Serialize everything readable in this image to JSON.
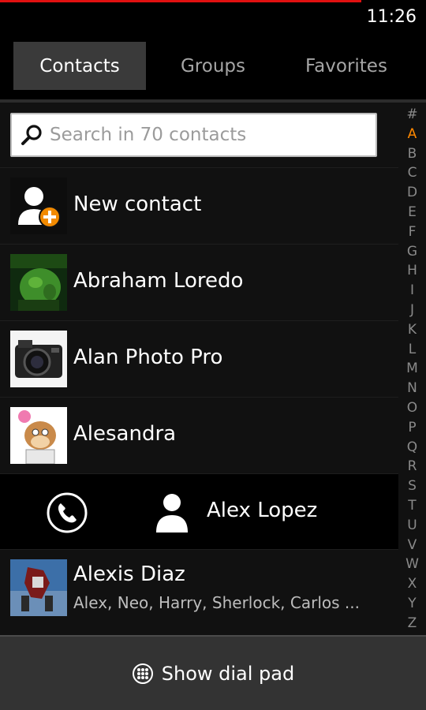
{
  "status": {
    "time": "11:26"
  },
  "tabs": [
    {
      "label": "Contacts",
      "active": true
    },
    {
      "label": "Groups",
      "active": false
    },
    {
      "label": "Favorites",
      "active": false
    }
  ],
  "search": {
    "placeholder": "Search in 70 contacts",
    "value": ""
  },
  "new_contact": {
    "label": "New contact",
    "icon": "add-person-icon"
  },
  "contacts": [
    {
      "name": "Abraham Loredo",
      "photo": "hulk-photo"
    },
    {
      "name": "Alan Photo Pro",
      "photo": "camera-photo"
    },
    {
      "name": "Alesandra",
      "photo": "cartoon-squirrel-photo"
    }
  ],
  "expanded_contact": {
    "name": "Alex Lopez",
    "call_icon": "phone-icon",
    "avatar_icon": "person-icon"
  },
  "last_contact": {
    "name": "Alexis Diaz",
    "subtitle": "Alex, Neo, Harry, Sherlock, Carlos ...",
    "photo": "robot-photo"
  },
  "index": {
    "letters": [
      "#",
      "A",
      "B",
      "C",
      "D",
      "E",
      "F",
      "G",
      "H",
      "I",
      "J",
      "K",
      "L",
      "M",
      "N",
      "O",
      "P",
      "Q",
      "R",
      "S",
      "T",
      "U",
      "V",
      "W",
      "X",
      "Y",
      "Z"
    ],
    "active": "A"
  },
  "footer": {
    "label": "Show dial pad",
    "icon": "dialpad-icon"
  },
  "colors": {
    "accent": "#ff8800",
    "status_line": "#e01010",
    "active_tab": "#3a3a3a"
  }
}
